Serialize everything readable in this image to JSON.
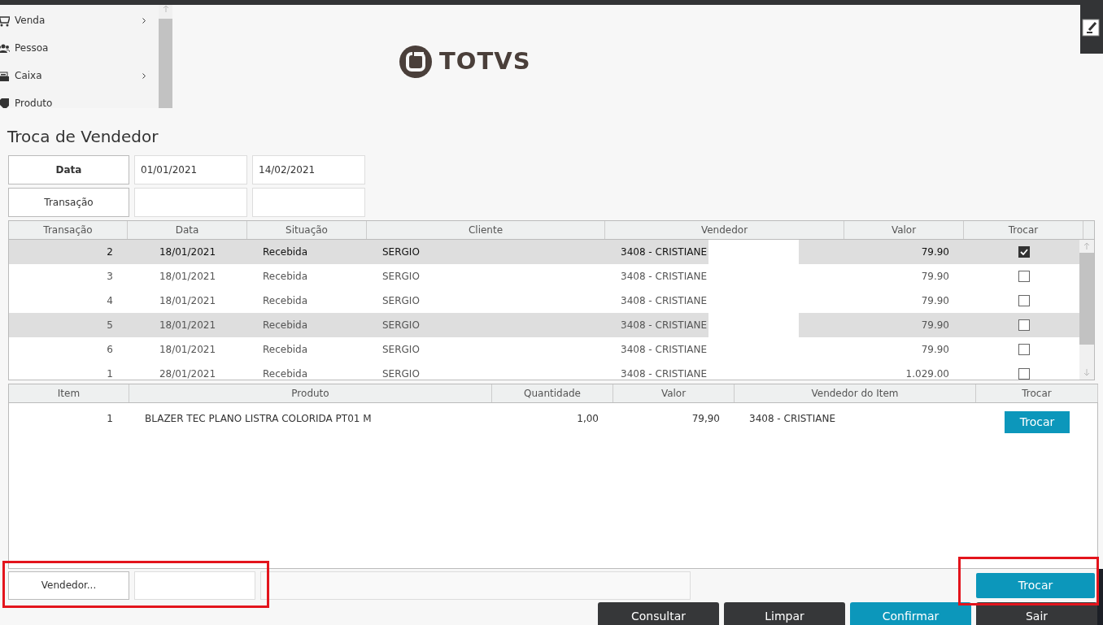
{
  "sidebar": {
    "items": [
      {
        "kind": "cart",
        "label": "Venda",
        "has_submenu": true
      },
      {
        "kind": "people",
        "label": "Pessoa",
        "has_submenu": false
      },
      {
        "kind": "register",
        "label": "Caixa",
        "has_submenu": true
      },
      {
        "kind": "tag",
        "label": "Produto",
        "has_submenu": false
      }
    ]
  },
  "logo": {
    "text": "TOTVS"
  },
  "page_title": "Troca de Vendedor",
  "filters": [
    {
      "label": "Data",
      "bold": true,
      "from": "01/01/2021",
      "to": "14/02/2021"
    },
    {
      "label": "Transação",
      "bold": false
    }
  ],
  "transactions": {
    "columns": [
      "Transação",
      "Data",
      "Situação",
      "Cliente",
      "Vendedor",
      "Valor",
      "Trocar"
    ],
    "rows": [
      {
        "transacao": "2",
        "data": "18/01/2021",
        "situacao": "Recebida",
        "cliente": "SERGIO",
        "vendedor": "3408 - CRISTIANE",
        "valor": "79.90",
        "checked": true,
        "selected": true,
        "hovered": true
      },
      {
        "transacao": "3",
        "data": "18/01/2021",
        "situacao": "Recebida",
        "cliente": "SERGIO",
        "vendedor": "3408 - CRISTIANE",
        "valor": "79.90",
        "checked": false,
        "selected": false,
        "hovered": false
      },
      {
        "transacao": "4",
        "data": "18/01/2021",
        "situacao": "Recebida",
        "cliente": "SERGIO",
        "vendedor": "3408 - CRISTIANE",
        "valor": "79.90",
        "checked": false,
        "selected": false,
        "hovered": false
      },
      {
        "transacao": "5",
        "data": "18/01/2021",
        "situacao": "Recebida",
        "cliente": "SERGIO",
        "vendedor": "3408 - CRISTIANE",
        "valor": "79.90",
        "checked": false,
        "selected": false,
        "hovered": true
      },
      {
        "transacao": "6",
        "data": "18/01/2021",
        "situacao": "Recebida",
        "cliente": "SERGIO",
        "vendedor": "3408 - CRISTIANE",
        "valor": "79.90",
        "checked": false,
        "selected": false,
        "hovered": false
      },
      {
        "transacao": "1",
        "data": "28/01/2021",
        "situacao": "Recebida",
        "cliente": "SERGIO",
        "vendedor": "3408 - CRISTIANE",
        "valor": "1.029.00",
        "checked": false,
        "selected": false,
        "hovered": false
      }
    ]
  },
  "items": {
    "columns": [
      "Item",
      "Produto",
      "Quantidade",
      "Valor",
      "Vendedor do Item",
      "Trocar"
    ],
    "rows": [
      {
        "item": "1",
        "produto": "BLAZER TEC PLANO LISTRA COLORIDA PT01 M",
        "quantidade": "1,00",
        "valor": "79,90",
        "vendedor": "3408 - CRISTIANE",
        "button": "Trocar"
      }
    ]
  },
  "vendor_picker": {
    "button": "Vendedor..."
  },
  "swap_button": "Trocar",
  "actions": [
    {
      "label": "Consultar",
      "primary": false
    },
    {
      "label": "Limpar",
      "primary": false
    },
    {
      "label": "Confirmar",
      "primary": true
    },
    {
      "label": "Sair",
      "primary": false
    }
  ]
}
